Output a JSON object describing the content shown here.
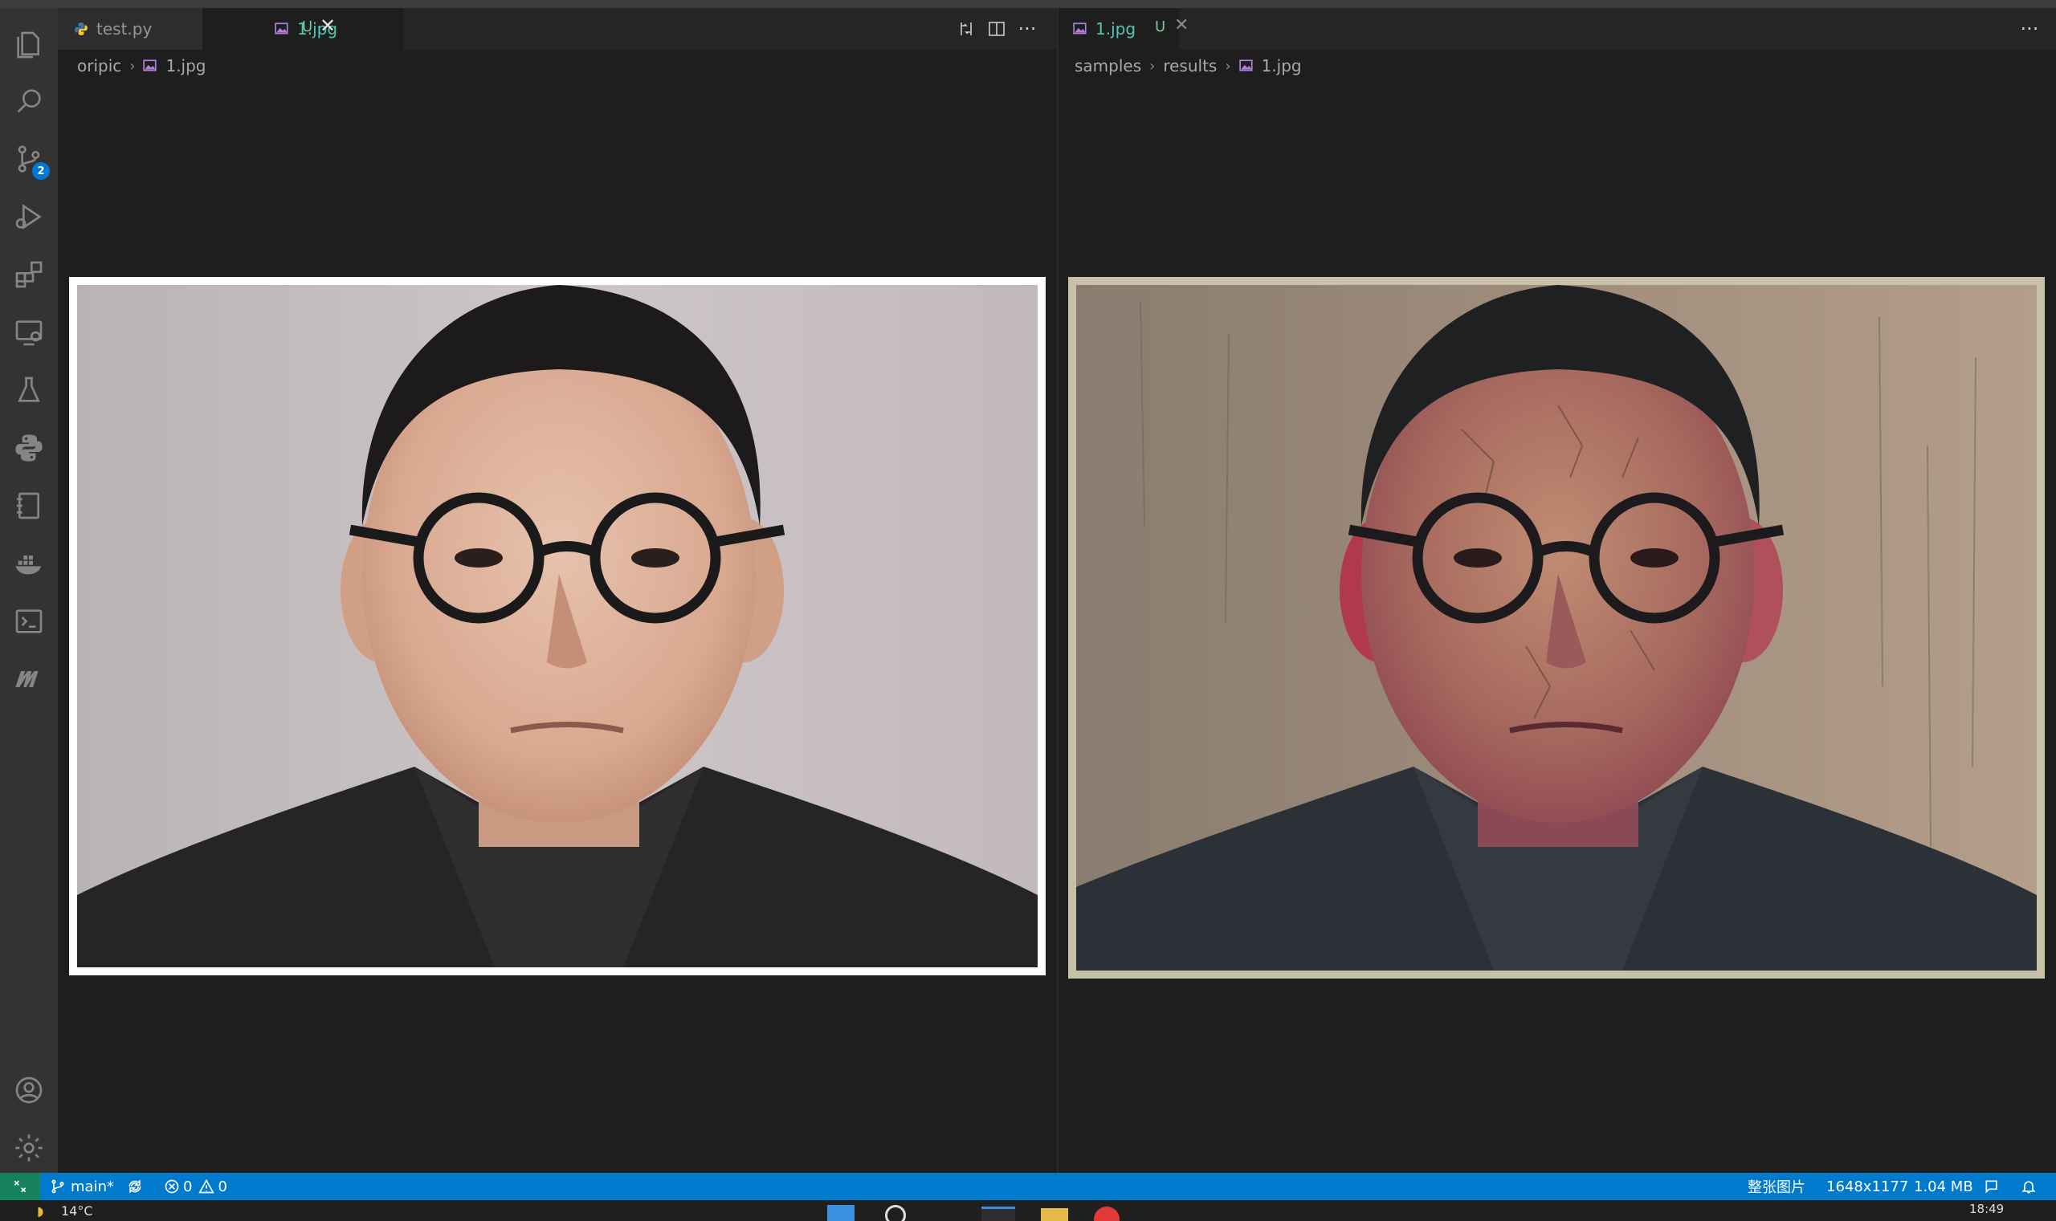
{
  "tabs_left": [
    {
      "label": "test.py",
      "state": "inactive"
    },
    {
      "label": "1.jpg",
      "state": "active",
      "status": "U"
    }
  ],
  "tabs_right": [
    {
      "label": "1.jpg",
      "state": "active",
      "status": "U"
    }
  ],
  "breadcrumb_left": [
    "oripic",
    "1.jpg"
  ],
  "breadcrumb_right": [
    "samples",
    "results",
    "1.jpg"
  ],
  "activity_bar": {
    "items": [
      "explorer-icon",
      "search-icon",
      "source-control-icon",
      "run-debug-icon",
      "extensions-icon",
      "remote-explorer-icon",
      "testing-icon",
      "python-icon",
      "notebook-icon",
      "docker-icon",
      "terminal-icon",
      "m-logo-icon",
      "accounts-icon",
      "manage-gear-icon"
    ],
    "source_control_badge": "2"
  },
  "status_bar": {
    "branch": "main*",
    "errors": "0",
    "warnings": "0",
    "image_type": "整张图片",
    "dimensions": "1648x1177",
    "file_size": "1.04 MB"
  },
  "taskbar": {
    "weather": "14°C",
    "clock": "18:49"
  },
  "colors": {
    "accent": "#007acc",
    "remote": "#16825d",
    "untracked": "#73c991",
    "active_tab_text": "#4ec9b0"
  }
}
